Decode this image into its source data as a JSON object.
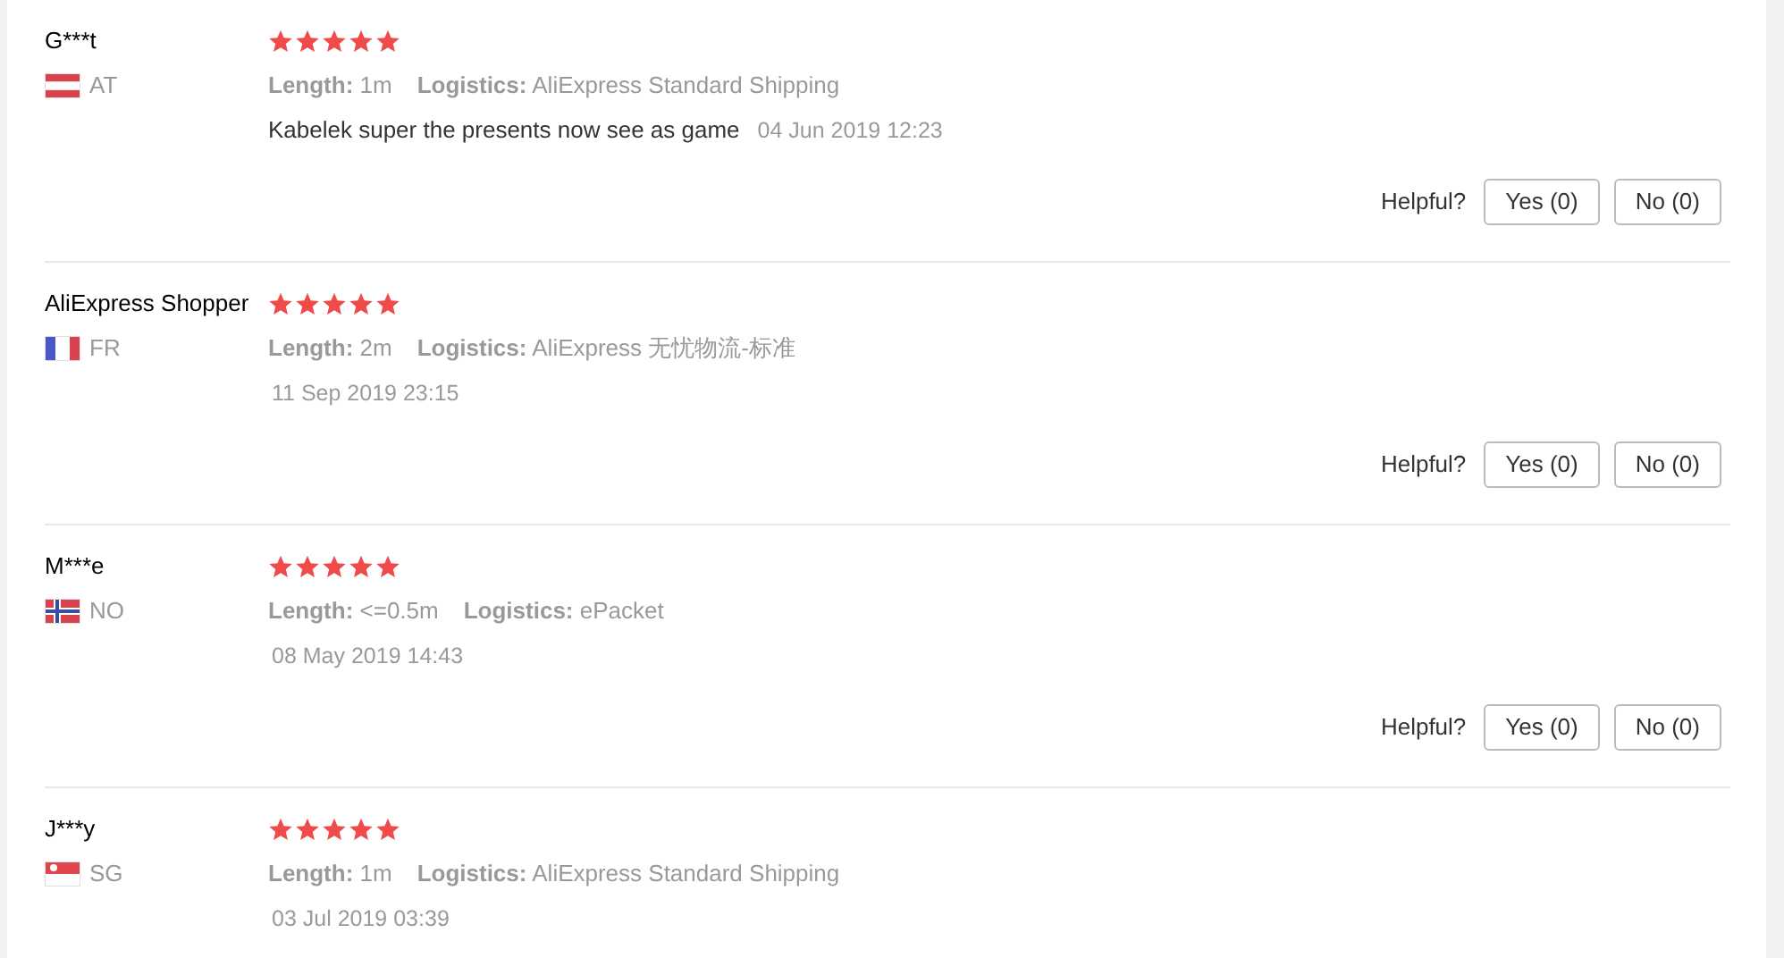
{
  "reviews": [
    {
      "name": "G***t",
      "flag": {
        "kind": "austria"
      },
      "country": "AT",
      "stars": 5,
      "length_label": "Length:",
      "length": "1m",
      "logistics_label": "Logistics:",
      "logistics": "AliExpress Standard Shipping",
      "comment": "Kabelek super the presents now see as game",
      "date": "04 Jun 2019 12:23",
      "helpful": {
        "label": "Helpful?",
        "yes": "Yes (0)",
        "no": "No (0)"
      }
    },
    {
      "name": "AliExpress Shopper",
      "flag": {
        "kind": "france"
      },
      "country": "FR",
      "stars": 5,
      "length_label": "Length:",
      "length": "2m",
      "logistics_label": "Logistics:",
      "logistics": "AliExpress 无忧物流-标准",
      "date": "11 Sep 2019 23:15",
      "helpful": {
        "label": "Helpful?",
        "yes": "Yes (0)",
        "no": "No (0)"
      }
    },
    {
      "name": "M***e",
      "flag": {
        "kind": "norway"
      },
      "country": "NO",
      "stars": 5,
      "length_label": "Length:",
      "length": "<=0.5m",
      "logistics_label": "Logistics:",
      "logistics": "ePacket",
      "date": "08 May 2019 14:43",
      "helpful": {
        "label": "Helpful?",
        "yes": "Yes (0)",
        "no": "No (0)"
      }
    },
    {
      "name": "J***y",
      "flag": {
        "kind": "singapore"
      },
      "country": "SG",
      "stars": 5,
      "length_label": "Length:",
      "length": "1m",
      "logistics_label": "Logistics:",
      "logistics": "AliExpress Standard Shipping",
      "date": "03 Jul 2019 03:39"
    }
  ]
}
